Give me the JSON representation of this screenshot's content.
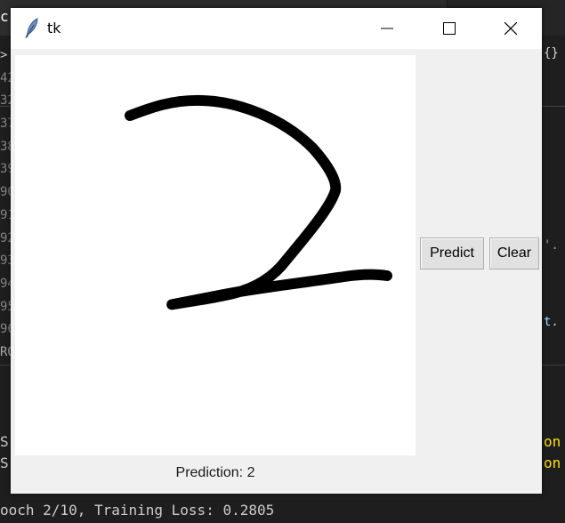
{
  "window": {
    "title": "tk",
    "controls": {
      "minimize": "minimize",
      "maximize": "maximize",
      "close": "close"
    }
  },
  "buttons": {
    "predict": "Predict",
    "clear": "Clear"
  },
  "prediction_label": "Prediction: 2",
  "canvas": {
    "drawn_digit": "2",
    "stroke_color": "#000000",
    "background": "#ffffff"
  },
  "background_editor": {
    "tab_fragment": "c",
    "gutter_lines": [
      ">",
      "42",
      "32",
      "37",
      "38",
      "39",
      "90",
      "91",
      "92",
      "93",
      "94",
      "95",
      "96",
      "RO"
    ],
    "right_fragments": {
      "braces": "{}",
      "line_a": "'.",
      "line_b": "t."
    },
    "terminal": {
      "line1": "S",
      "line2": "S",
      "line3": "ooch 2/10, Training Loss: 0.2805",
      "right1": "on",
      "right2": "on"
    }
  },
  "colors": {
    "editor_bg": "#1e1e1e",
    "window_bg": "#f0f0f0",
    "titlebar_bg": "#ffffff",
    "button_bg": "#e1e1e1",
    "terminal_yellow": "#ffe000"
  }
}
